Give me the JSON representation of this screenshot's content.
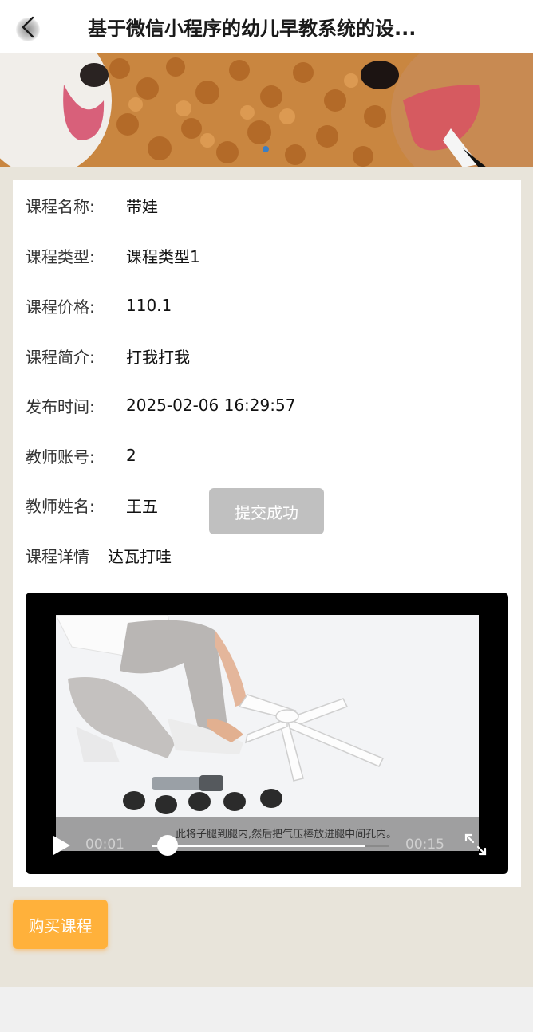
{
  "header": {
    "title": "基于微信小程序的幼儿早教系统的设..."
  },
  "course": {
    "fields": [
      {
        "label": "课程名称:",
        "value": "带娃"
      },
      {
        "label": "课程类型:",
        "value": "课程类型1"
      },
      {
        "label": "课程价格:",
        "value": "110.1"
      },
      {
        "label": "课程简介:",
        "value": "打我打我"
      },
      {
        "label": "发布时间:",
        "value": "2025-02-06 16:29:57"
      },
      {
        "label": "教师账号:",
        "value": "2"
      },
      {
        "label": "教师姓名:",
        "value": "王五"
      }
    ],
    "detail_label": "课程详情",
    "detail_value": "达瓦打哇"
  },
  "toast": {
    "text": "提交成功"
  },
  "video": {
    "current_time": "00:01",
    "total_time": "00:15",
    "progress": 0.067,
    "buffered": 0.9,
    "subtitle": "此将子腿到腿内,然后把气压棒放进腿中间孔内。"
  },
  "actions": {
    "buy_label": "购买课程"
  },
  "colors": {
    "accent": "#ffb13b",
    "page_background": "#e8e4da",
    "toast_background": "#c0c0c0",
    "banner_dot": "#3b7fc4"
  },
  "icons": {
    "back": "chevron-left-icon",
    "play": "play-icon",
    "fullscreen": "fullscreen-icon"
  }
}
